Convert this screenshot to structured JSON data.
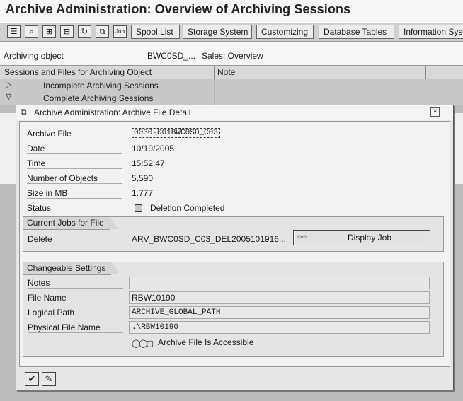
{
  "window_title": "Archive Administration: Overview of Archiving Sessions",
  "toolbar": {
    "icons": [
      "details-icon",
      "zoom-icon",
      "new-icon",
      "stop-icon",
      "refresh-icon",
      "copy-icon",
      "job-icon"
    ],
    "buttons": [
      "Spool List",
      "Storage System",
      "Customizing",
      "Database Tables",
      "Information System"
    ]
  },
  "archiving_object": {
    "label": "Archiving object",
    "value": "BWC0SD_...",
    "description": "Sales: Overview"
  },
  "grid": {
    "headers": [
      "Sessions and Files for Archiving Object",
      "Note"
    ],
    "rows": [
      {
        "label": "Incomplete Archiving Sessions",
        "expanded": false
      },
      {
        "label": "Complete Archiving Sessions",
        "expanded": true
      }
    ]
  },
  "dialog": {
    "title": "Archive Administration: Archive File Detail",
    "fields": {
      "archive_file": {
        "label": "Archive File",
        "value": "0030-001BWC0SD_C03"
      },
      "date": {
        "label": "Date",
        "value": "10/19/2005"
      },
      "time": {
        "label": "Time",
        "value": "15:52:47"
      },
      "number_of_objects": {
        "label": "Number of Objects",
        "value": "5,590"
      },
      "size_mb": {
        "label": "Size in MB",
        "value": "1.777"
      },
      "status": {
        "label": "Status",
        "value": "Deletion Completed"
      }
    },
    "jobs_group": {
      "title": "Current Jobs for File",
      "delete_label": "Delete",
      "delete_value": "ARV_BWC0SD_C03_DEL2005101916...",
      "display_job_button": "Display Job"
    },
    "settings_group": {
      "title": "Changeable Settings",
      "notes": {
        "label": "Notes",
        "value": ""
      },
      "file_name": {
        "label": "File Name",
        "value": "RBW10190"
      },
      "logical_path": {
        "label": "Logical Path",
        "value": "ARCHIVE_GLOBAL_PATH"
      },
      "physical_file_name": {
        "label": "Physical File Name",
        "value": ".\\RBW10190"
      },
      "accessible_text": "Archive File Is Accessible"
    },
    "footer": {
      "icons": [
        "confirm-check-icon",
        "edit-check-icon"
      ]
    }
  }
}
